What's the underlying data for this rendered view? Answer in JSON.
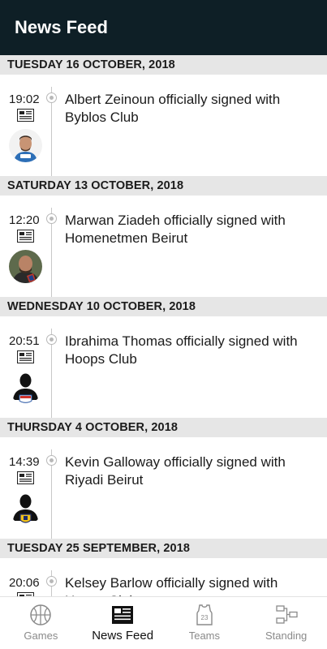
{
  "app_bar": {
    "title": "News Feed"
  },
  "feed": [
    {
      "date": "TUESDAY 16 OCTOBER, 2018",
      "time": "19:02",
      "headline": "Albert Zeinoun officially signed with Byblos Club",
      "avatar": "player-photo"
    },
    {
      "date": "SATURDAY 13 OCTOBER, 2018",
      "time": "12:20",
      "headline": "Marwan Ziadeh officially signed with Homenetmen Beirut",
      "avatar": "player-photo"
    },
    {
      "date": "WEDNESDAY 10 OCTOBER, 2018",
      "time": "20:51",
      "headline": "Ibrahima Thomas officially signed with Hoops Club",
      "avatar": "silhouette"
    },
    {
      "date": "THURSDAY 4 OCTOBER, 2018",
      "time": "14:39",
      "headline": "Kevin Galloway officially signed with Riyadi Beirut",
      "avatar": "silhouette"
    },
    {
      "date": "TUESDAY 25 SEPTEMBER, 2018",
      "time": "20:06",
      "headline": "Kelsey Barlow officially signed with Hoops Club",
      "avatar": "silhouette"
    }
  ],
  "bottom_nav": {
    "items": [
      {
        "label": "Games",
        "icon": "basketball-icon"
      },
      {
        "label": "News Feed",
        "icon": "newspaper-icon",
        "active": true
      },
      {
        "label": "Teams",
        "icon": "jersey-icon",
        "jersey_number": "23"
      },
      {
        "label": "Standing",
        "icon": "bracket-icon"
      }
    ]
  },
  "colors": {
    "app_bar": "#0e1f26",
    "date_header_bg": "#e6e6e6",
    "nav_inactive": "#8a8a8a",
    "nav_active": "#111111"
  }
}
